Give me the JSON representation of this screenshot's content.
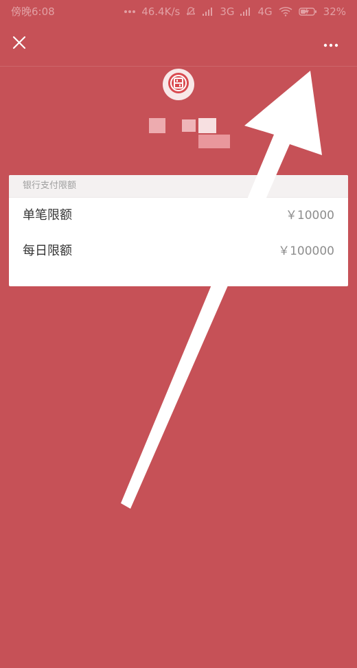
{
  "status_bar": {
    "time": "傍晚6:08",
    "network_speed": "46.4K/s",
    "network_3g": "3G",
    "network_4g": "4G",
    "battery": "32%"
  },
  "top_bar": {
    "close_icon": "close-icon",
    "more_icon": "more-icon"
  },
  "header": {
    "logo_icon": "bank-logo-icon"
  },
  "card": {
    "title": "银行支付限额",
    "rows": [
      {
        "label": "单笔限额",
        "value": "￥10000"
      },
      {
        "label": "每日限额",
        "value": "￥100000"
      }
    ]
  }
}
